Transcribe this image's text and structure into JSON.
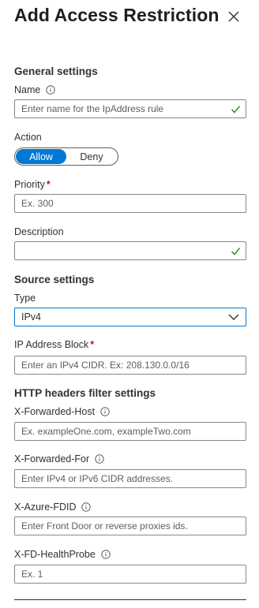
{
  "panel": {
    "title": "Add Access Restriction",
    "close_icon": "close-icon"
  },
  "general": {
    "heading": "General settings",
    "name_label": "Name",
    "name_placeholder": "Enter name for the IpAddress rule",
    "action_label": "Action",
    "action_options": [
      "Allow",
      "Deny"
    ],
    "action_selected": "Allow",
    "priority_label": "Priority",
    "priority_placeholder": "Ex. 300",
    "description_label": "Description",
    "description_placeholder": ""
  },
  "source": {
    "heading": "Source settings",
    "type_label": "Type",
    "type_value": "IPv4",
    "ip_block_label": "IP Address Block",
    "ip_block_placeholder": "Enter an IPv4 CIDR. Ex: 208.130.0.0/16"
  },
  "http": {
    "heading": "HTTP headers filter settings",
    "forwarded_host_label": "X-Forwarded-Host",
    "forwarded_host_placeholder": "Ex. exampleOne.com, exampleTwo.com",
    "forwarded_for_label": "X-Forwarded-For",
    "forwarded_for_placeholder": "Enter IPv4 or IPv6 CIDR addresses.",
    "azure_fdid_label": "X-Azure-FDID",
    "azure_fdid_placeholder": "Enter Front Door or reverse proxies ids.",
    "fd_healthprobe_label": "X-FD-HealthProbe",
    "fd_healthprobe_placeholder": "Ex. 1"
  },
  "required_marker": "*",
  "colors": {
    "accent": "#0078d4",
    "valid_check": "#107c10",
    "required": "#a4262c"
  }
}
